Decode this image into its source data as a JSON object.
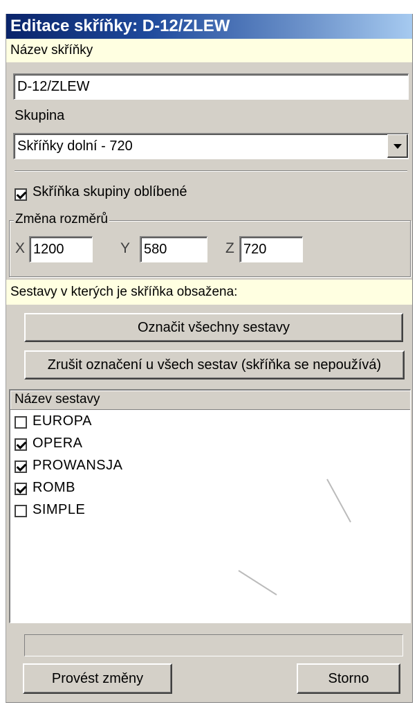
{
  "window": {
    "title": "Editace skříňky: D-12/ZLEW"
  },
  "name_section": {
    "header": "Název skříňky",
    "value": "D-12/ZLEW"
  },
  "group": {
    "label": "Skupina",
    "selected": "Skříňky dolní - 720"
  },
  "favorite": {
    "label": "Skříňka skupiny oblíbené",
    "checked": true
  },
  "dimensions": {
    "legend": "Změna rozměrů",
    "x_label": "X",
    "x_value": "1200",
    "y_label": "Y",
    "y_value": "580",
    "z_label": "Z",
    "z_value": "720"
  },
  "sets": {
    "header": "Sestavy v kterých je skříňka obsažena:",
    "mark_all_label": "Označit všechny sestavy",
    "unmark_all_label": "Zrušit označení u všech sestav (skříňka se nepoužívá)",
    "column_header": "Název sestavy",
    "items": [
      {
        "label": "EUROPA",
        "checked": false
      },
      {
        "label": "OPERA",
        "checked": true
      },
      {
        "label": "PROWANSJA",
        "checked": true
      },
      {
        "label": "ROMB",
        "checked": true
      },
      {
        "label": "SIMPLE",
        "checked": false
      }
    ]
  },
  "footer": {
    "apply_label": "Provést změny",
    "cancel_label": "Storno"
  },
  "colors": {
    "title_start": "#0a246a",
    "title_end": "#a6caf0",
    "info_bg": "#ffffe1",
    "panel_bg": "#d4d0c8"
  }
}
